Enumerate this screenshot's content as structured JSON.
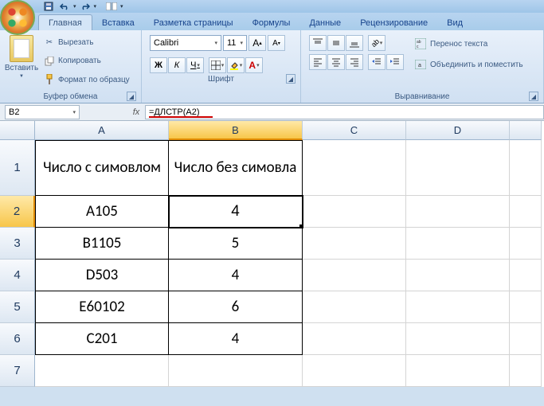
{
  "qat": {
    "save": "save",
    "undo": "undo",
    "redo": "redo"
  },
  "tabs": {
    "home": "Главная",
    "insert": "Вставка",
    "layout": "Разметка страницы",
    "formulas": "Формулы",
    "data": "Данные",
    "review": "Рецензирование",
    "view": "Вид"
  },
  "clipboard": {
    "paste": "Вставить",
    "cut": "Вырезать",
    "copy": "Копировать",
    "format_painter": "Формат по образцу",
    "group": "Буфер обмена"
  },
  "font": {
    "name": "Calibri",
    "size": "11",
    "group": "Шрифт",
    "bold": "Ж",
    "italic": "К",
    "underline": "Ч"
  },
  "alignment": {
    "group": "Выравнивание",
    "wrap": "Перенос текста",
    "merge": "Объединить и поместить"
  },
  "namebox": "B2",
  "fx": "fx",
  "formula": "=ДЛСТР(A2)",
  "cols": {
    "A": "A",
    "B": "B",
    "C": "C",
    "D": "D"
  },
  "rows": [
    "1",
    "2",
    "3",
    "4",
    "5",
    "6",
    "7"
  ],
  "cells": {
    "A1": "Число с симовлом",
    "B1": "Число без симовла",
    "A2": "A105",
    "B2": "4",
    "A3": "B1105",
    "B3": "5",
    "A4": "D503",
    "B4": "4",
    "A5": "E60102",
    "B5": "6",
    "A6": "C201",
    "B6": "4"
  },
  "colwidths": {
    "A": 168,
    "B": 168,
    "C": 130,
    "D": 130,
    "E": 40
  },
  "rowheights": {
    "1": 70,
    "other": 40
  }
}
